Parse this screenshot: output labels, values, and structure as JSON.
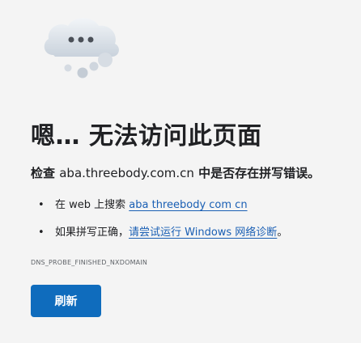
{
  "error": {
    "title": "嗯… 无法访问此页面",
    "subtitle_prefix": "检查 ",
    "domain": "aba.threebody.com.cn",
    "subtitle_suffix": " 中是否存在拼写错误。",
    "suggestions": [
      {
        "bullet": "•",
        "prefix": "在 web 上搜索 ",
        "link": "aba threebody com cn",
        "suffix": ""
      },
      {
        "bullet": "•",
        "prefix": "如果拼写正确，",
        "link": "请尝试运行 Windows 网络诊断",
        "suffix": "。"
      }
    ],
    "code": "DNS_PROBE_FINISHED_NXDOMAIN",
    "refresh_label": "刷新"
  },
  "icon": {
    "name": "disconnected-cloud-icon"
  },
  "colors": {
    "background": "#f4f4f4",
    "primary_button": "#0f6cbd",
    "link": "#1a5fb4",
    "text": "#202124"
  }
}
